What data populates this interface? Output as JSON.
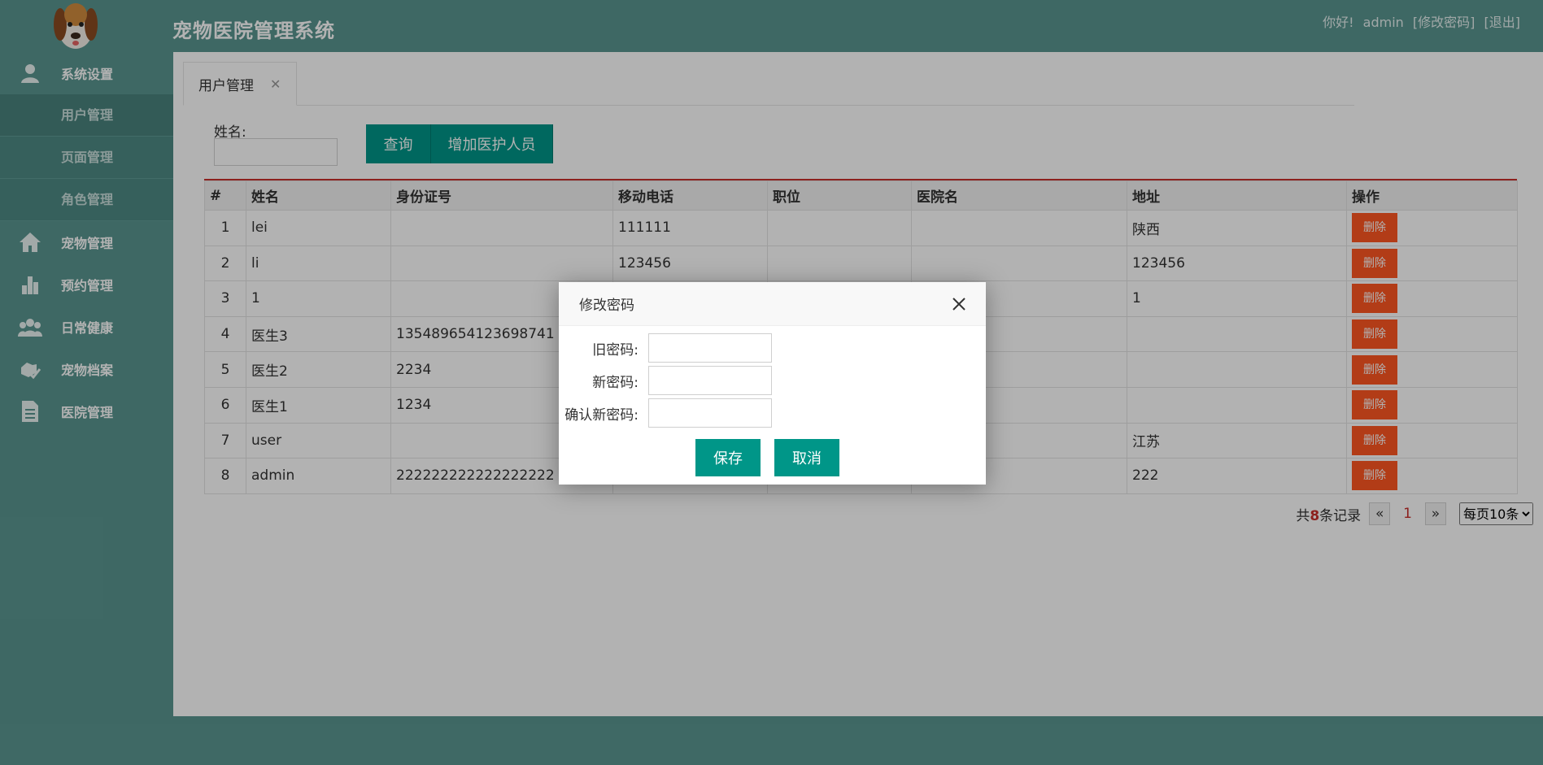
{
  "header": {
    "title": "宠物医院管理系统",
    "greeting": "你好!",
    "username": "admin",
    "change_password": "[修改密码]",
    "logout": "[退出]"
  },
  "sidebar": {
    "items": [
      {
        "label": "系统设置",
        "icon": "user-icon"
      },
      {
        "label": "用户管理",
        "sub": true
      },
      {
        "label": "页面管理",
        "sub": true
      },
      {
        "label": "角色管理",
        "sub": true
      },
      {
        "label": "宠物管理",
        "icon": "home-icon"
      },
      {
        "label": "预约管理",
        "icon": "bar-chart-icon"
      },
      {
        "label": "日常健康",
        "icon": "group-icon"
      },
      {
        "label": "宠物档案",
        "icon": "hand-check-icon"
      },
      {
        "label": "医院管理",
        "icon": "document-icon"
      }
    ]
  },
  "tabs": [
    {
      "label": "用户管理",
      "close": "✕"
    }
  ],
  "search": {
    "label": "姓名:",
    "value": "",
    "query_button": "查询",
    "add_button": "增加医护人员"
  },
  "table": {
    "headers": [
      "#",
      "姓名",
      "身份证号",
      "移动电话",
      "职位",
      "医院名",
      "地址",
      "操作"
    ],
    "delete_label": "删除",
    "rows": [
      [
        "1",
        "lei",
        "",
        "111111",
        "",
        "",
        "陕西"
      ],
      [
        "2",
        "li",
        "",
        "123456",
        "",
        "",
        "123456"
      ],
      [
        "3",
        "1",
        "",
        "",
        "",
        "",
        "1"
      ],
      [
        "4",
        "医生3",
        "135489654123698741",
        "",
        "",
        "",
        ""
      ],
      [
        "5",
        "医生2",
        "2234",
        "",
        "",
        "",
        ""
      ],
      [
        "6",
        "医生1",
        "1234",
        "",
        "",
        "",
        ""
      ],
      [
        "7",
        "user",
        "",
        "",
        "",
        "",
        "江苏"
      ],
      [
        "8",
        "admin",
        "222222222222222222",
        "",
        "",
        "",
        "222"
      ]
    ]
  },
  "pager": {
    "total_prefix": "共",
    "total": "8",
    "total_suffix": "条记录",
    "prev": "«",
    "current": "1",
    "next": "»",
    "page_size": "每页10条"
  },
  "dialog": {
    "title": "修改密码",
    "old_password_label": "旧密码:",
    "new_password_label": "新密码:",
    "confirm_password_label": "确认新密码:",
    "save": "保存",
    "cancel": "取消"
  },
  "colors": {
    "accent": "#009688",
    "sidebar": "#5a9690",
    "danger": "#ff5722"
  }
}
